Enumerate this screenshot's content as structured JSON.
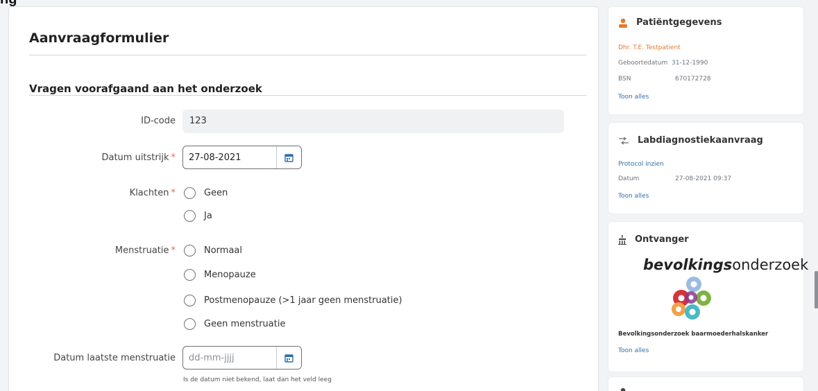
{
  "clip_text": "ng",
  "form": {
    "title": "Aanvraagformulier",
    "section_title": "Vragen voorafgaand aan het onderzoek",
    "id_code": {
      "label": "ID-code",
      "value": "123"
    },
    "datum_uitstrijk": {
      "label": "Datum uitstrijk",
      "required": "*",
      "value": "27-08-2021"
    },
    "klachten": {
      "label": "Klachten",
      "required": "*",
      "options": [
        "Geen",
        "Ja"
      ]
    },
    "menstruatie": {
      "label": "Menstruatie",
      "required": "*",
      "options": [
        "Normaal",
        "Menopauze",
        "Postmenopauze (>1 jaar geen menstruatie)",
        "Geen menstruatie"
      ]
    },
    "datum_laatste_menstruatie": {
      "label": "Datum laatste menstruatie",
      "placeholder": "dd-mm-jjjj",
      "hint": "Is de datum niet bekend, laat dan het veld leeg"
    }
  },
  "patient": {
    "title": "Patiëntgegevens",
    "name": "Dhr. T.E. Testpatient",
    "dob_label": "Geboortedatum",
    "dob_value": "31-12-1990",
    "bsn_label": "BSN",
    "bsn_value": "670172728",
    "show_all": "Toon alles"
  },
  "lab": {
    "title": "Labdiagnostiekaanvraag",
    "protocol_link": "Protocol inzien",
    "date_label": "Datum",
    "date_value": "27-08-2021 09:37",
    "show_all": "Toon alles"
  },
  "recipient": {
    "title": "Ontvanger",
    "logo_bold": "bevolkings",
    "logo_rest": "onderzoek",
    "name": "Bevolkingsonderzoek baarmoederhalskanker",
    "show_all": "Toon alles"
  },
  "colors": {
    "accent_orange": "#e07a2f",
    "link_blue": "#2f6ea8",
    "required_red": "#e06b5c"
  },
  "icons": {
    "patient": "person-icon",
    "lab": "arrows-exchange-icon",
    "recipient": "building-icon",
    "calendar": "calendar-icon"
  }
}
